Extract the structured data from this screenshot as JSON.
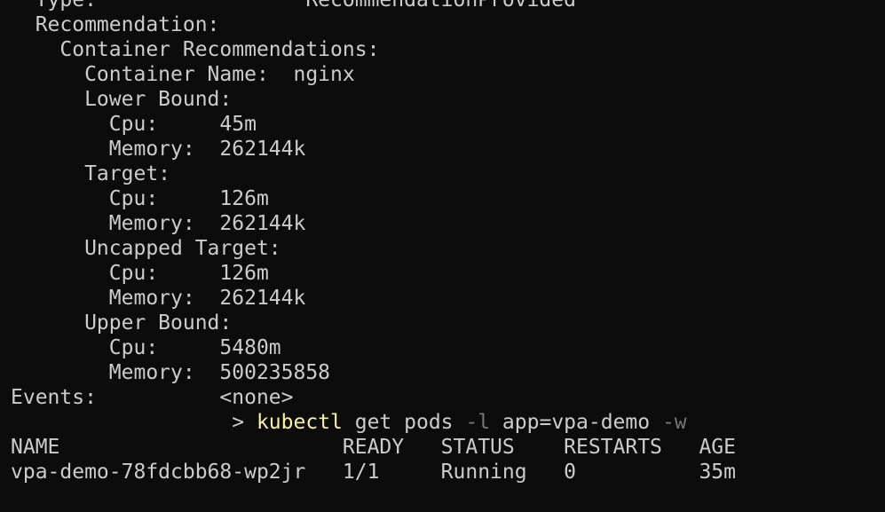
{
  "terminal": {
    "top_cut_line": "  Type:                 RecommendationProvided",
    "lines": [
      "  Recommendation:",
      "    Container Recommendations:",
      "      Container Name:  nginx",
      "      Lower Bound:",
      "        Cpu:     45m",
      "        Memory:  262144k",
      "      Target:",
      "        Cpu:     126m",
      "        Memory:  262144k",
      "      Uncapped Target:",
      "        Cpu:     126m",
      "        Memory:  262144k",
      "      Upper Bound:",
      "        Cpu:     5480m",
      "        Memory:  500235858",
      "Events:          <none>"
    ],
    "prompt_prefix": "                  > ",
    "command": {
      "program": "kubectl",
      "sep1": " get pods ",
      "flag1": "-l",
      "sep2": " app=vpa-demo ",
      "flag2": "-w"
    },
    "table": {
      "header": "NAME                       READY   STATUS    RESTARTS   AGE",
      "rows": [
        "vpa-demo-78fdcbb68-wp2jr   1/1     Running   0          35m"
      ]
    }
  },
  "colors": {
    "background": "#0c0c0c",
    "text": "#cccccc",
    "command": "#f9f1a5",
    "flag": "#767676"
  }
}
